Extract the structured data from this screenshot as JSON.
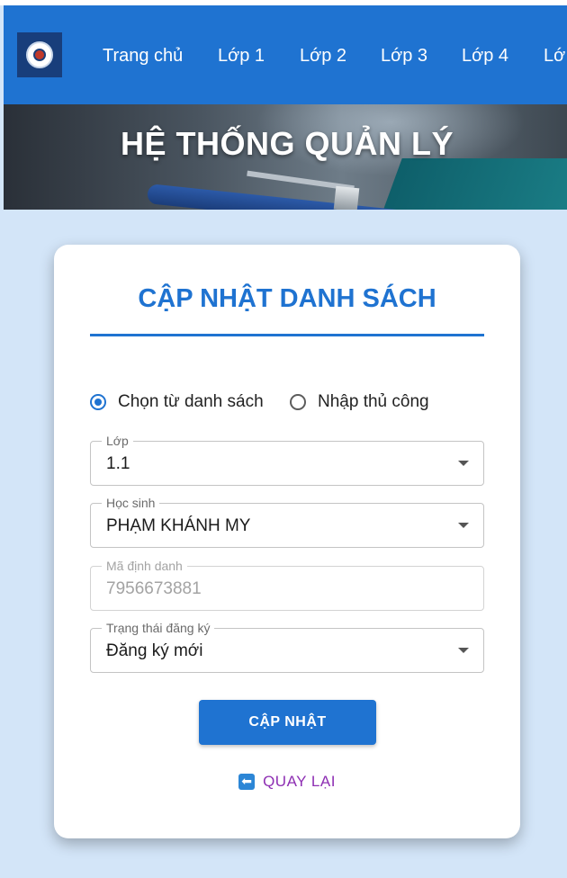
{
  "nav": {
    "logo_icon": "school-emblem-icon",
    "items": [
      {
        "label": "Trang chủ"
      },
      {
        "label": "Lớp 1"
      },
      {
        "label": "Lớp 2"
      },
      {
        "label": "Lớp 3"
      },
      {
        "label": "Lớp 4"
      },
      {
        "label": "Lớ"
      }
    ]
  },
  "hero": {
    "title": "HỆ THỐNG QUẢN LÝ"
  },
  "form": {
    "title": "CẬP NHẬT DANH SÁCH",
    "mode_options": [
      {
        "label": "Chọn từ danh sách",
        "checked": true
      },
      {
        "label": "Nhập thủ công",
        "checked": false
      }
    ],
    "fields": {
      "class": {
        "label": "Lớp",
        "value": "1.1"
      },
      "student": {
        "label": "Học sinh",
        "value": "PHẠM KHÁNH MY"
      },
      "student_id": {
        "label": "Mã định danh",
        "value": "7956673881",
        "disabled": true
      },
      "status": {
        "label": "Trạng thái đăng ký",
        "value": "Đăng ký mới"
      }
    },
    "submit_label": "CẬP NHẬT",
    "back": {
      "icon": "back-arrow-icon",
      "label": "QUAY LẠI"
    }
  },
  "colors": {
    "primary": "#1f73d1",
    "page_background": "#d3e5f8",
    "back_link": "#8e2fb3"
  }
}
